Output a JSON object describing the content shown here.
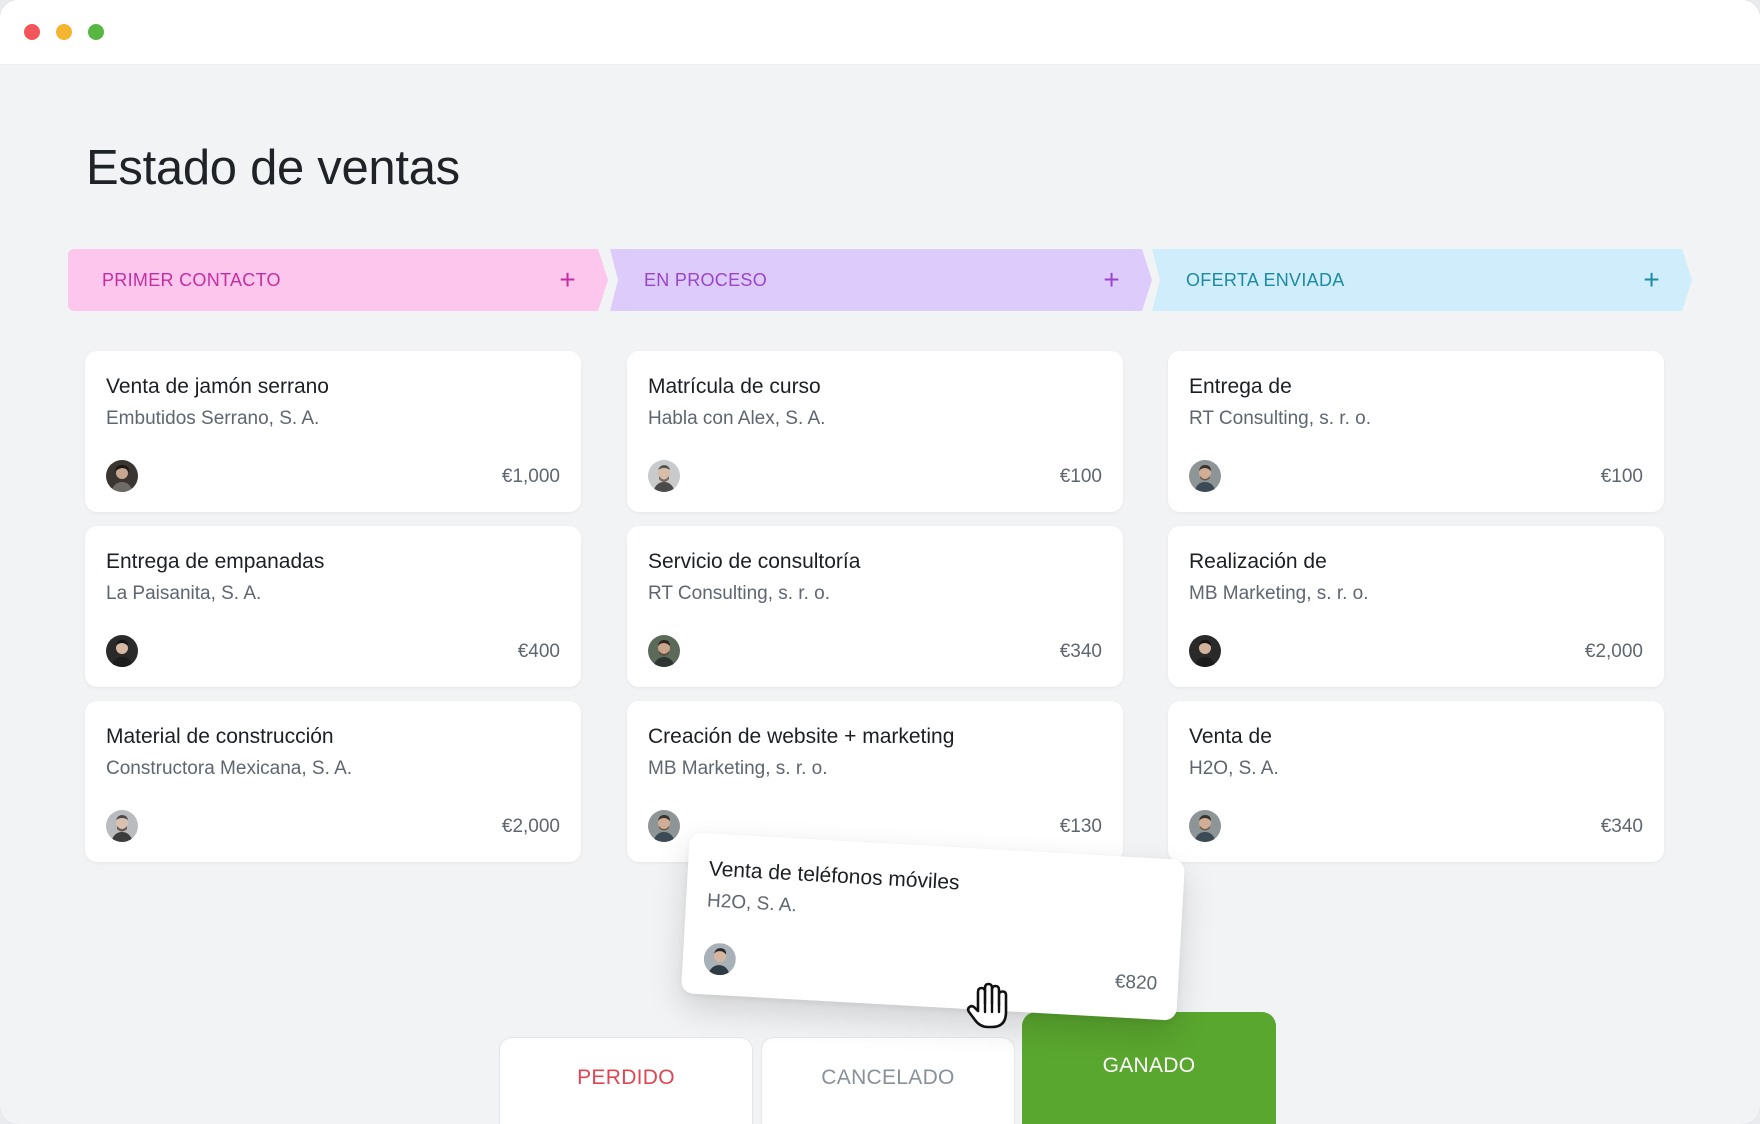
{
  "page": {
    "title": "Estado de ventas"
  },
  "stages": [
    {
      "label": "PRIMER CONTACTO",
      "add": "+",
      "color": "#c42fa0",
      "bg": "#fdc6ec"
    },
    {
      "label": "EN PROCESO",
      "add": "+",
      "color": "#9a45c9",
      "bg": "#ddcbfb"
    },
    {
      "label": "OFERTA ENVIADA",
      "add": "+",
      "color": "#1d8ba3",
      "bg": "#d0edfb"
    }
  ],
  "columns": [
    [
      {
        "title": "Venta de jamón serrano",
        "company": "Embutidos Serrano, S. A.",
        "amount": "€1,000"
      },
      {
        "title": "Entrega de empanadas",
        "company": "La Paisanita, S. A.",
        "amount": "€400"
      },
      {
        "title": "Material de construcción",
        "company": "Constructora Mexicana, S. A.",
        "amount": "€2,000"
      }
    ],
    [
      {
        "title": "Matrícula de curso",
        "company": "Habla con Alex, S. A.",
        "amount": "€100"
      },
      {
        "title": "Servicio de consultoría",
        "company": "RT Consulting, s. r. o.",
        "amount": "€340"
      },
      {
        "title": "Creación de website + marketing",
        "company": "MB Marketing, s. r. o.",
        "amount": "€130"
      }
    ],
    [
      {
        "title": "Entrega de",
        "company": "RT Consulting, s. r. o.",
        "amount": "€100"
      },
      {
        "title": "Realización de",
        "company": "MB Marketing, s. r. o.",
        "amount": "€2,000"
      },
      {
        "title": "Venta de",
        "company": "H2O, S. A.",
        "amount": "€340"
      }
    ]
  ],
  "dragging_card": {
    "title": "Venta de teléfonos móviles",
    "company": "H2O, S. A.",
    "amount": "€820"
  },
  "outcomes": {
    "lost": "PERDIDO",
    "cancelled": "CANCELADO",
    "won": "GANADO"
  },
  "colors": {
    "won": "#5aa72f",
    "lost": "#e14551",
    "cancelled": "#8a9099"
  },
  "icons": {
    "cursor": "grab-hand-icon",
    "avatar": "user-avatar-icon"
  }
}
